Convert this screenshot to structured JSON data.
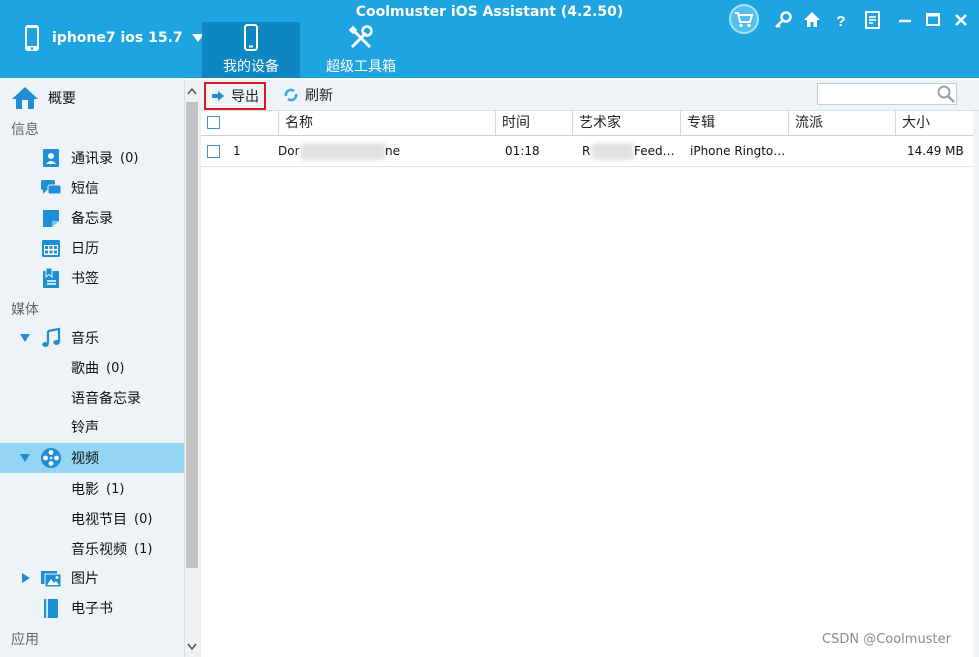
{
  "app": {
    "title": "Coolmuster iOS Assistant (4.2.50)"
  },
  "device": {
    "name": "iphone7 ios 15.7"
  },
  "nav": {
    "my_device": "我的设备",
    "super_toolbox": "超级工具箱"
  },
  "window_icons": [
    "cart-icon",
    "key-icon",
    "home-icon",
    "help-icon",
    "feedback-icon",
    "minimize-icon",
    "maximize-icon",
    "close-icon"
  ],
  "sidebar": {
    "overview": "概要",
    "cat_info": "信息",
    "contacts": {
      "label": "通讯录",
      "count": "(0)"
    },
    "messages": "短信",
    "notes": "备忘录",
    "calendar": "日历",
    "bookmarks": "书签",
    "cat_media": "媒体",
    "music": "音乐",
    "songs": {
      "label": "歌曲",
      "count": "(0)"
    },
    "voice_memos": "语音备忘录",
    "ringtones": "铃声",
    "video": "视频",
    "movies": {
      "label": "电影",
      "count": "(1)"
    },
    "tv_shows": {
      "label": "电视节目",
      "count": "(0)"
    },
    "music_videos": {
      "label": "音乐视频",
      "count": "(1)"
    },
    "photos": "图片",
    "ebooks": "电子书",
    "cat_apps": "应用"
  },
  "toolbar": {
    "export": "导出",
    "refresh": "刷新",
    "search_placeholder": ""
  },
  "table": {
    "columns": [
      "名称",
      "时间",
      "艺术家",
      "专辑",
      "流派",
      "大小"
    ],
    "rows": [
      {
        "index": "1",
        "name_start": "Dor",
        "name_end": "ne",
        "time": "01:18",
        "artist_start": "R",
        "artist_end": "Feed…",
        "album": "iPhone Ringto…",
        "genre": "",
        "size": "14.49 MB"
      }
    ]
  },
  "watermark": "CSDN @Coolmuster",
  "colors": {
    "titlebar": "#1ea4e0",
    "active_tab": "#0e86c2",
    "selected_item": "#93d5f3",
    "export_outline": "#e0181e"
  }
}
